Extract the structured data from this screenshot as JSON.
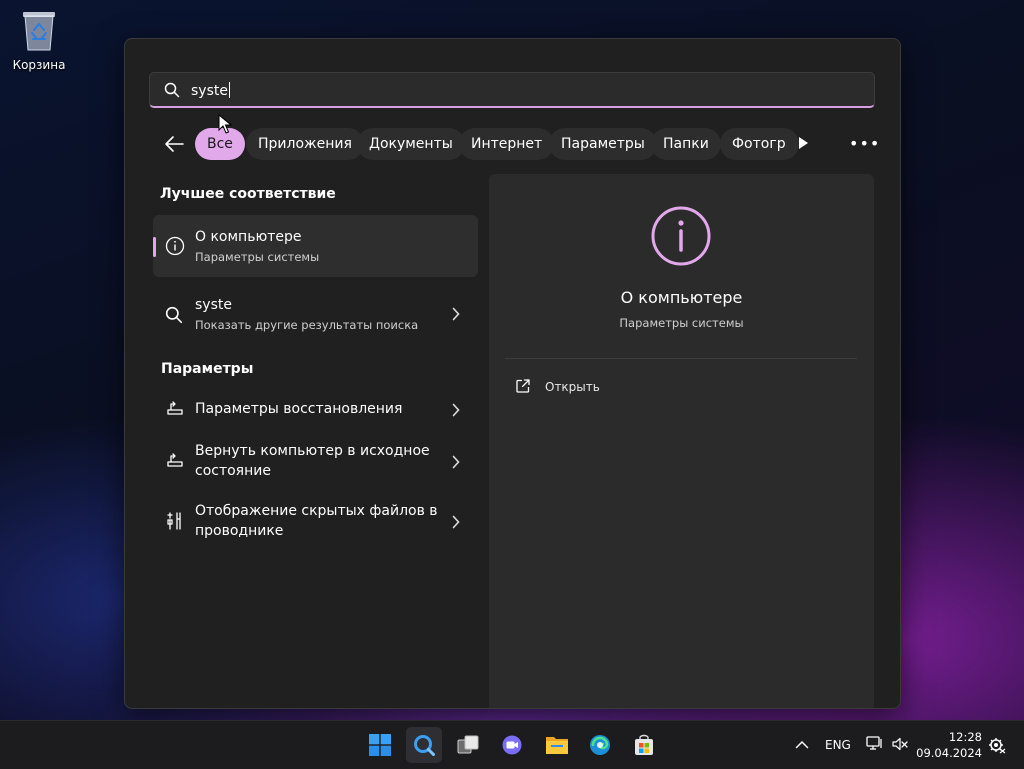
{
  "desktop": {
    "recycle_bin_label": "Корзина"
  },
  "search": {
    "query": "syste"
  },
  "filters": {
    "chips": [
      {
        "label": "Все",
        "active": true
      },
      {
        "label": "Приложения",
        "active": false
      },
      {
        "label": "Документы",
        "active": false
      },
      {
        "label": "Интернет",
        "active": false
      },
      {
        "label": "Параметры",
        "active": false
      },
      {
        "label": "Папки",
        "active": false
      },
      {
        "label": "Фотогр",
        "active": false
      }
    ]
  },
  "best_match": {
    "section_title": "Лучшее соответствие",
    "title": "О компьютере",
    "subtitle": "Параметры системы"
  },
  "web_result": {
    "title": "syste",
    "subtitle": "Показать другие результаты поиска"
  },
  "settings_section": {
    "title": "Параметры",
    "items": [
      {
        "label_line1": "Параметры восстановления",
        "label_line2": "",
        "icon": "recovery-icon"
      },
      {
        "label_line1": "Вернуть компьютер в исходное",
        "label_line2": "состояние",
        "icon": "reset-pc-icon"
      },
      {
        "label_line1": "Отображение скрытых файлов в",
        "label_line2": "проводнике",
        "icon": "developer-tools-icon"
      }
    ]
  },
  "preview": {
    "title": "О компьютере",
    "subtitle": "Параметры системы",
    "open_label": "Открыть"
  },
  "taskbar": {
    "apps": [
      "start-icon",
      "search-icon",
      "task-view-icon",
      "teams-chat-icon",
      "file-explorer-icon",
      "edge-icon",
      "store-icon"
    ],
    "language": "ENG",
    "time": "12:28",
    "date": "09.04.2024"
  },
  "colors": {
    "accent": "#e1a8ea",
    "panel_bg": "#202020",
    "preview_bg": "#2b2b2b"
  }
}
